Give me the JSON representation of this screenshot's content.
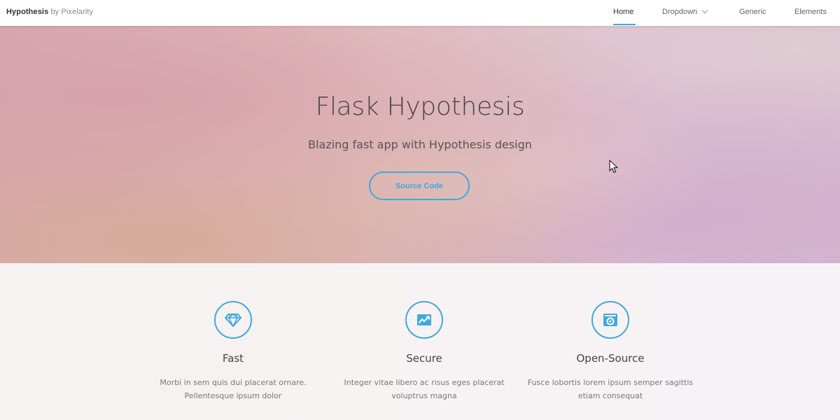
{
  "header": {
    "brand_strong": "Hypothesis",
    "brand_rest": " by Pixelarity",
    "nav": [
      {
        "label": "Home",
        "active": true
      },
      {
        "label": "Dropdown",
        "has_dropdown": true
      },
      {
        "label": "Generic"
      },
      {
        "label": "Elements"
      }
    ]
  },
  "banner": {
    "title": "Flask Hypothesis",
    "subtitle": "Blazing fast app with Hypothesis design",
    "button_label": "Source Code"
  },
  "features": [
    {
      "icon": "diamond-icon",
      "title": "Fast",
      "desc_line1": "Morbi in sem quis dui placerat ornare.",
      "desc_line2": "Pellentesque ipsum dolor"
    },
    {
      "icon": "chart-icon",
      "title": "Secure",
      "desc_line1": "Integer vitae libero ac risus eges placerat",
      "desc_line2": "voluptrus magna"
    },
    {
      "icon": "camera-icon",
      "title": "Open-Source",
      "desc_line1": "Fusce lobortis lorem ipsum semper sagittis",
      "desc_line2": "etiam consequat"
    }
  ],
  "colors": {
    "accent": "#3fa9e0",
    "header_bg": "#ffffff"
  }
}
